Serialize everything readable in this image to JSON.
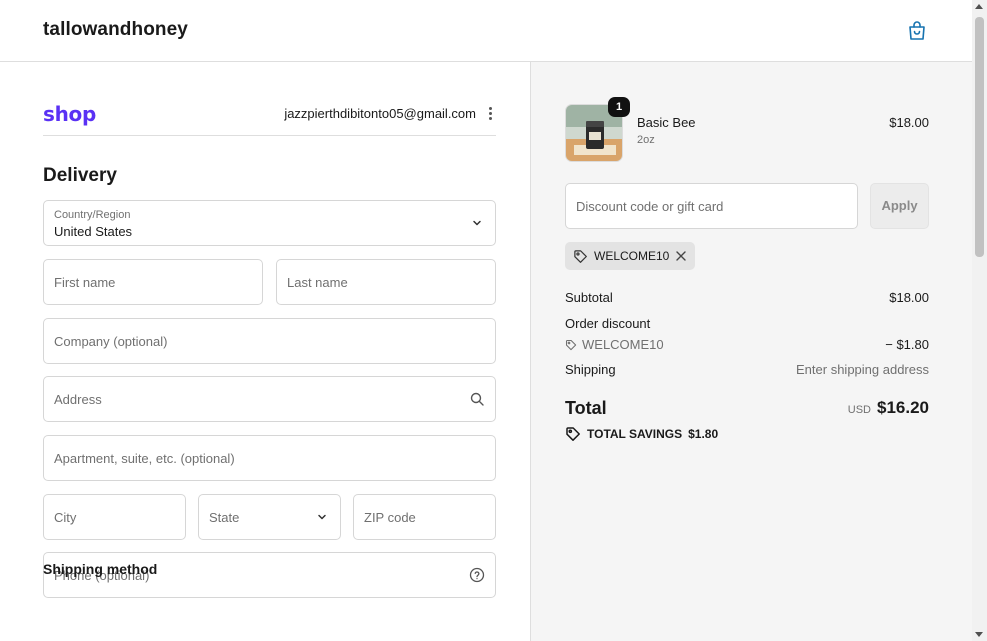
{
  "header": {
    "brand": "tallowandhoney",
    "cart_icon": "shopping-bag-icon"
  },
  "account": {
    "shop_logo": "shop",
    "email": "jazzpierthdibitonto05@gmail.com"
  },
  "delivery": {
    "title": "Delivery",
    "country_label": "Country/Region",
    "country_value": "United States",
    "first_name_placeholder": "First name",
    "last_name_placeholder": "Last name",
    "company_placeholder": "Company (optional)",
    "address_placeholder": "Address",
    "apartment_placeholder": "Apartment, suite, etc. (optional)",
    "city_placeholder": "City",
    "state_placeholder": "State",
    "zip_placeholder": "ZIP code",
    "phone_placeholder": "Phone (optional)"
  },
  "shipping_method": {
    "title": "Shipping method"
  },
  "order": {
    "item": {
      "quantity": "1",
      "name": "Basic Bee",
      "variant": "2oz",
      "price": "$18.00"
    },
    "discount_placeholder": "Discount code or gift card",
    "apply_label": "Apply",
    "applied_code": "WELCOME10",
    "subtotal_label": "Subtotal",
    "subtotal_value": "$18.00",
    "order_discount_label": "Order discount",
    "order_discount_code": "WELCOME10",
    "order_discount_value": "− $1.80",
    "shipping_label": "Shipping",
    "shipping_value": "Enter shipping address",
    "total_label": "Total",
    "total_currency": "USD",
    "total_value": "$16.20",
    "savings_label": "TOTAL SAVINGS",
    "savings_value": "$1.80"
  },
  "colors": {
    "shop_brand": "#5a31f4",
    "accent_link": "#1773b0",
    "summary_bg": "#f5f5f5"
  }
}
